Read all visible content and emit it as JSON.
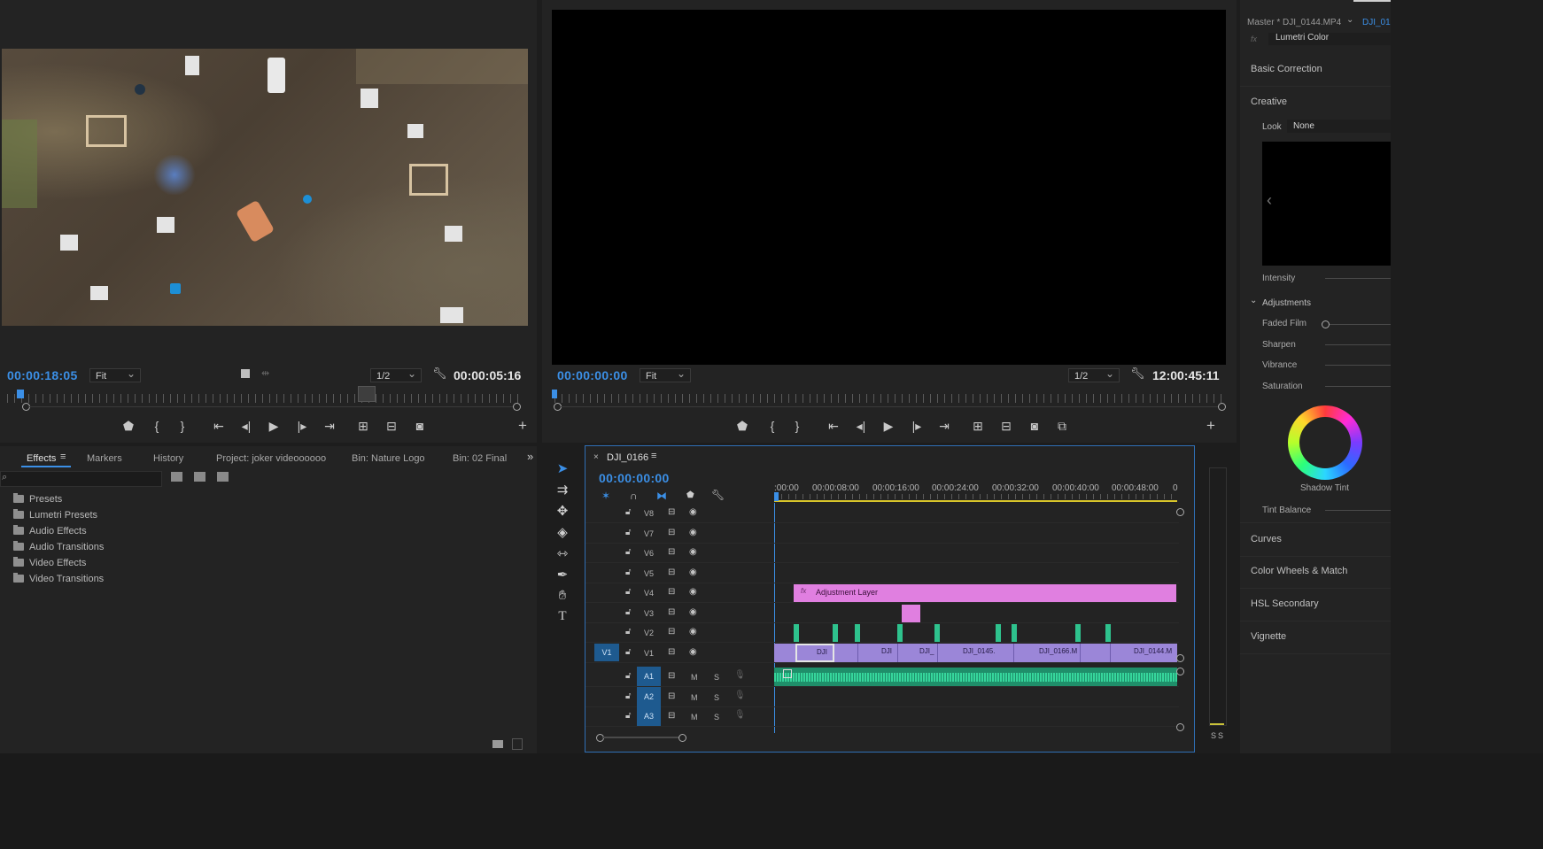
{
  "source_monitor": {
    "timecode": "00:00:18:05",
    "fit": "Fit",
    "resolution": "1/2",
    "duration": "00:00:05:16"
  },
  "program_monitor": {
    "timecode": "00:00:00:00",
    "fit": "Fit",
    "resolution": "1/2",
    "duration": "12:00:45:11"
  },
  "effects_panel": {
    "tabs": [
      "Effects",
      "Markers",
      "History",
      "Project: joker videoooooo",
      "Bin: Nature Logo",
      "Bin: 02 Final"
    ],
    "tree": [
      "Presets",
      "Lumetri Presets",
      "Audio Effects",
      "Audio Transitions",
      "Video Effects",
      "Video Transitions"
    ]
  },
  "timeline": {
    "sequence_name": "DJI_0166",
    "timecode": "00:00:00:00",
    "ruler_labels": [
      ":00:00",
      "00:00:08:00",
      "00:00:16:00",
      "00:00:24:00",
      "00:00:32:00",
      "00:00:40:00",
      "00:00:48:00",
      "0"
    ],
    "video_tracks": [
      "V8",
      "V7",
      "V6",
      "V5",
      "V4",
      "V3",
      "V2",
      "V1"
    ],
    "audio_tracks": [
      "A1",
      "A2",
      "A3"
    ],
    "v1_source": "V1",
    "mute_label": "M",
    "solo_label": "S",
    "adjustment_layer": "Adjustment Layer",
    "v1_clips": [
      "DJI",
      "DJI",
      "DJI_",
      "DJI_0145.",
      "DJI_0166.M",
      "",
      "DJI_0144.M"
    ],
    "meter_labels": [
      "S",
      "S"
    ]
  },
  "lumetri": {
    "master_label": "Master * DJI_0144.MP4",
    "clip_link": "DJI_01",
    "effect": "Lumetri Color",
    "sections": [
      "Basic Correction",
      "Creative"
    ],
    "look_label": "Look",
    "look_value": "None",
    "intensity": "Intensity",
    "adjustments": "Adjustments",
    "sliders": [
      "Faded Film",
      "Sharpen",
      "Vibrance",
      "Saturation"
    ],
    "shadow_tint": "Shadow Tint",
    "tint_balance": "Tint Balance",
    "bottom_sections": [
      "Curves",
      "Color Wheels & Match",
      "HSL Secondary",
      "Vignette"
    ]
  },
  "colors": {
    "accent_blue": "#3b8fe6",
    "adjustment_pink": "#e07fe0",
    "clip_purple": "#9b86d8",
    "audio_green": "#2ec28d"
  }
}
